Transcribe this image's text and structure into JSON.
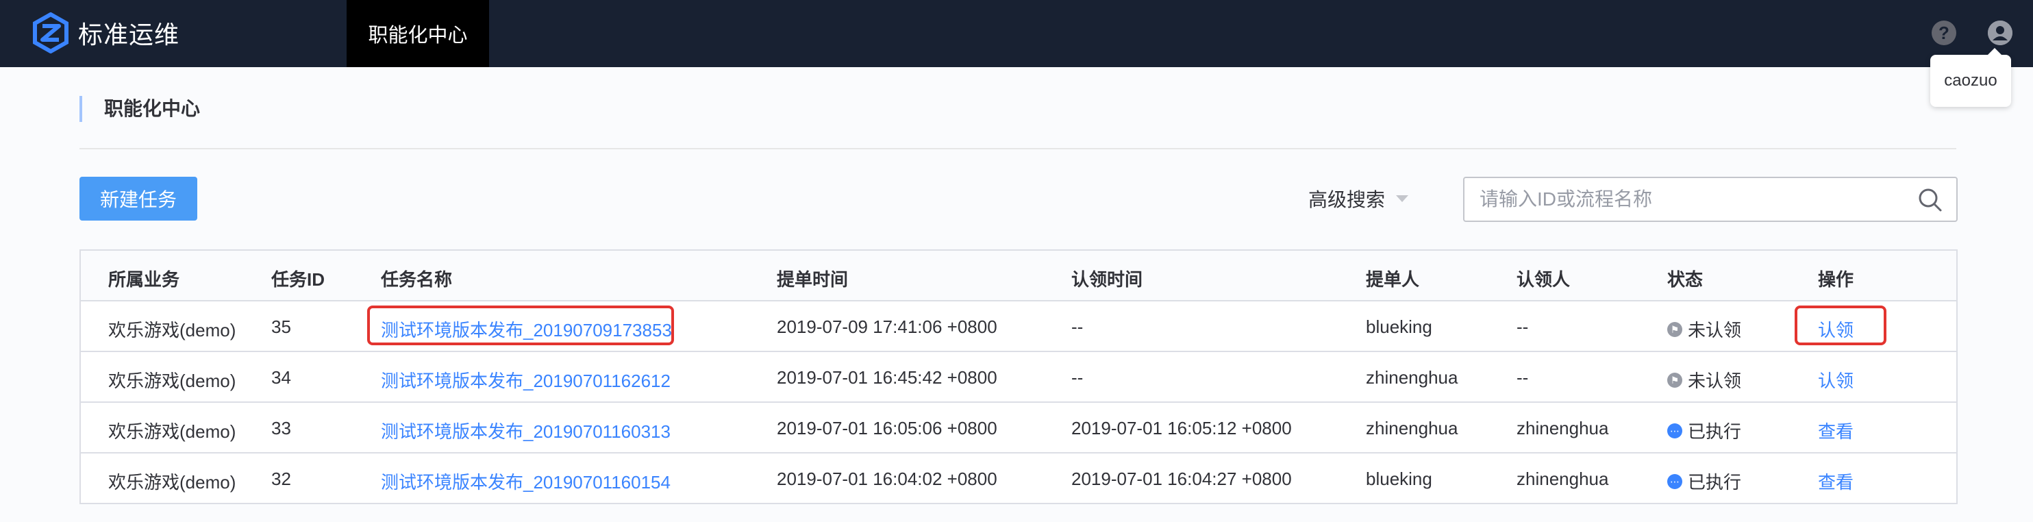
{
  "app": {
    "title": "标准运维",
    "active_nav": "职能化中心"
  },
  "user": {
    "name": "caozuo"
  },
  "page": {
    "title": "职能化中心"
  },
  "toolbar": {
    "new_button": "新建任务",
    "advanced_search": "高级搜索",
    "search_placeholder": "请输入ID或流程名称"
  },
  "table": {
    "headers": [
      "所属业务",
      "任务ID",
      "任务名称",
      "提单时间",
      "认领时间",
      "提单人",
      "认领人",
      "状态",
      "操作"
    ],
    "rows": [
      {
        "business": "欢乐游戏(demo)",
        "id": "35",
        "name": "测试环境版本发布_20190709173853",
        "submit_time": "2019-07-09 17:41:06 +0800",
        "claim_time": "--",
        "submitter": "blueking",
        "claimer": "--",
        "status": "未认领",
        "action": "认领"
      },
      {
        "business": "欢乐游戏(demo)",
        "id": "34",
        "name": "测试环境版本发布_20190701162612",
        "submit_time": "2019-07-01 16:45:42 +0800",
        "claim_time": "--",
        "submitter": "zhinenghua",
        "claimer": "--",
        "status": "未认领",
        "action": "认领"
      },
      {
        "business": "欢乐游戏(demo)",
        "id": "33",
        "name": "测试环境版本发布_20190701160313",
        "submit_time": "2019-07-01 16:05:06 +0800",
        "claim_time": "2019-07-01 16:05:12 +0800",
        "submitter": "zhinenghua",
        "claimer": "zhinenghua",
        "status": "已执行",
        "action": "查看"
      },
      {
        "business": "欢乐游戏(demo)",
        "id": "32",
        "name": "测试环境版本发布_20190701160154",
        "submit_time": "2019-07-01 16:04:02 +0800",
        "claim_time": "2019-07-01 16:04:27 +0800",
        "submitter": "blueking",
        "claimer": "zhinenghua",
        "status": "已执行",
        "action": "查看"
      }
    ]
  },
  "colors": {
    "topbar": "#182132",
    "primary": "#3a84ff",
    "button": "#4a9cf6",
    "highlight": "#e3342f"
  }
}
